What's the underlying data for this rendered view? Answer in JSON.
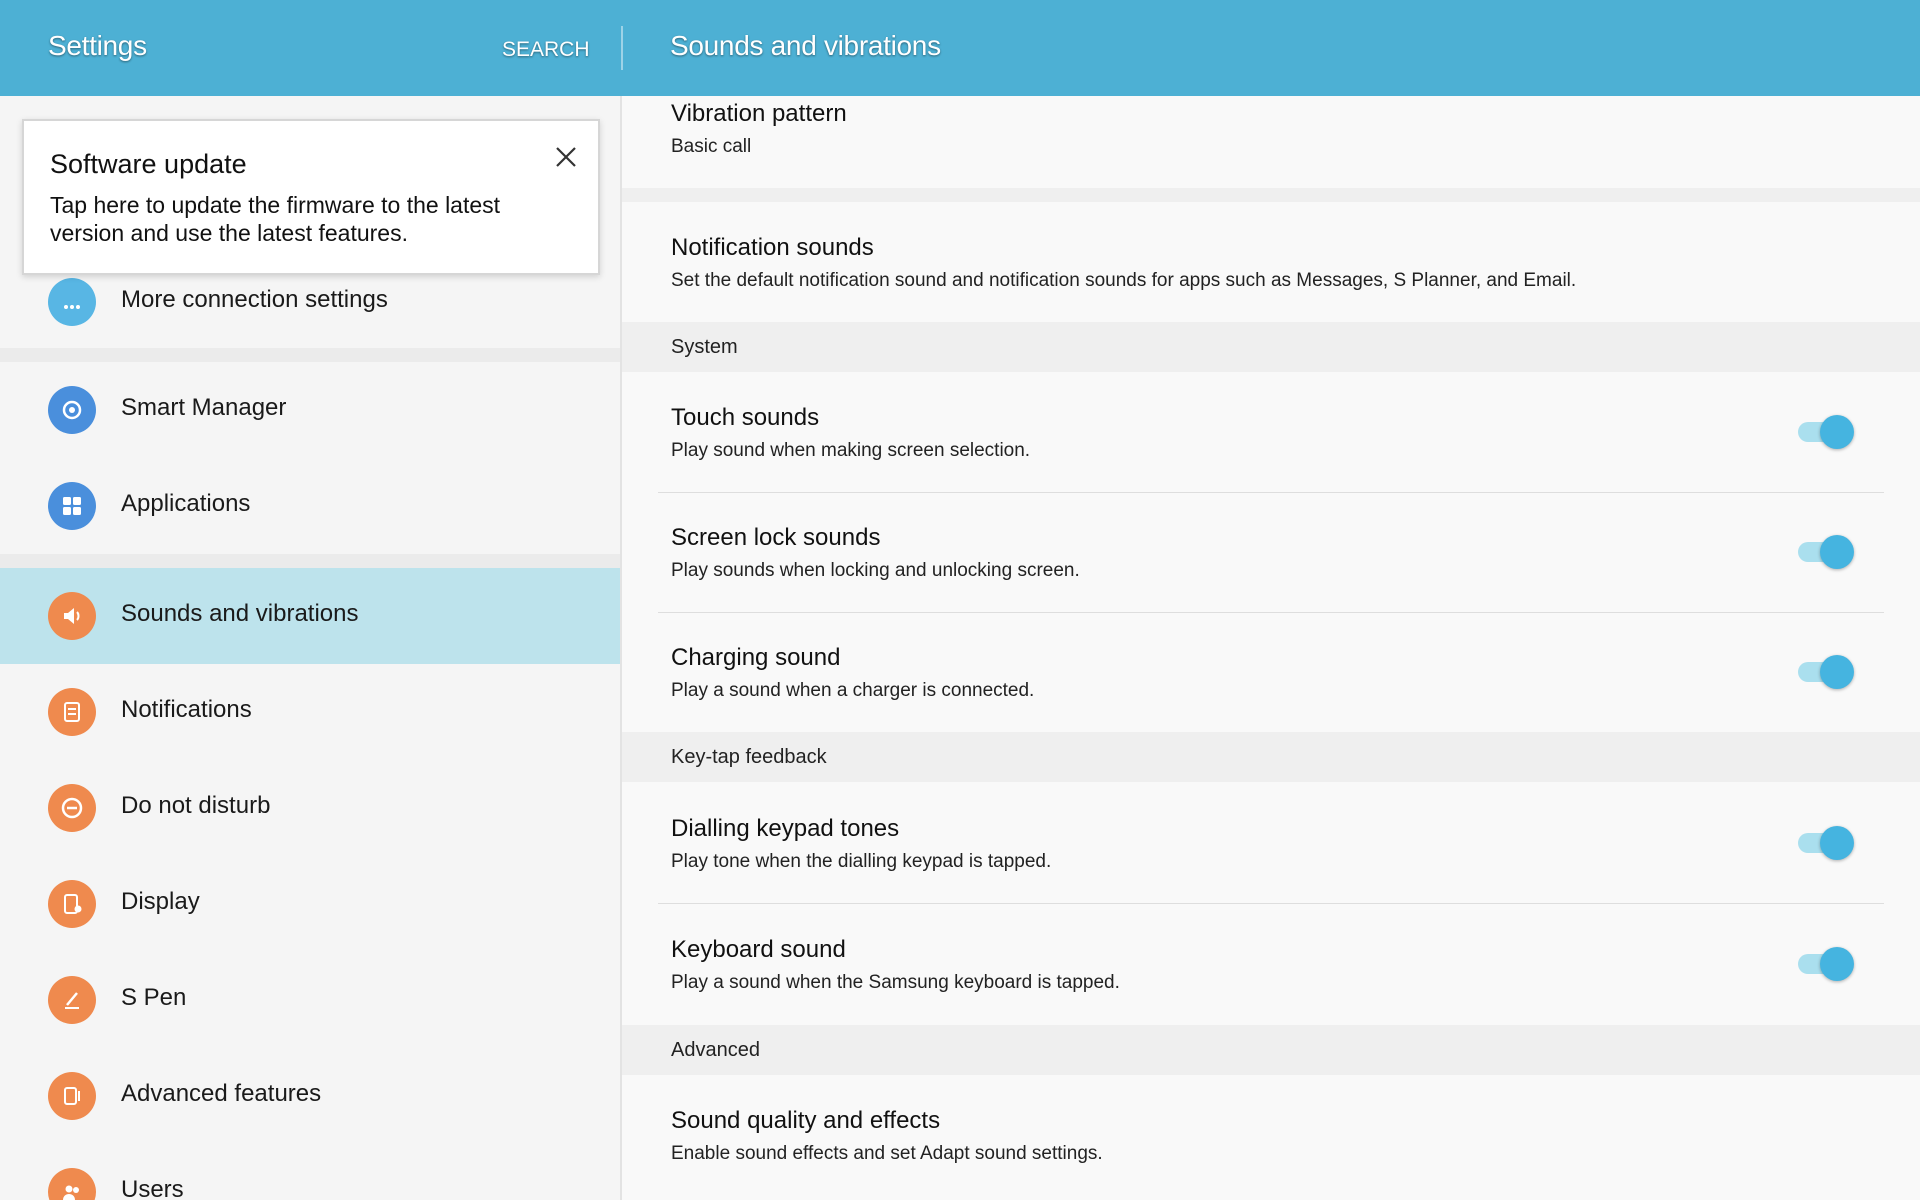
{
  "header": {
    "left_title": "Settings",
    "search_label": "SEARCH",
    "right_title": "Sounds and vibrations",
    "bg_color": "#4db0d4"
  },
  "popup": {
    "title": "Software update",
    "text": "Tap here to update the firmware to the latest version and use the latest features.",
    "close_icon": "close-icon"
  },
  "sidebar": {
    "items": [
      {
        "label": "More connection settings",
        "icon": "more-connections-icon",
        "color": "#58b6e4"
      },
      {
        "label": "Smart Manager",
        "icon": "smart-manager-icon",
        "color": "#4a8fdc"
      },
      {
        "label": "Applications",
        "icon": "applications-icon",
        "color": "#4a8fdc"
      },
      {
        "label": "Sounds and vibrations",
        "icon": "speaker-icon",
        "color": "#ef8a4e",
        "selected": true
      },
      {
        "label": "Notifications",
        "icon": "notifications-icon",
        "color": "#ef8a4e"
      },
      {
        "label": "Do not disturb",
        "icon": "do-not-disturb-icon",
        "color": "#ef8a4e"
      },
      {
        "label": "Display",
        "icon": "display-icon",
        "color": "#ef8a4e"
      },
      {
        "label": "S Pen",
        "icon": "s-pen-icon",
        "color": "#ef8a4e"
      },
      {
        "label": "Advanced features",
        "icon": "advanced-features-icon",
        "color": "#ef8a4e"
      },
      {
        "label": "Users",
        "icon": "users-icon",
        "color": "#ef8a4e"
      }
    ],
    "selected_color": "#bde3ec"
  },
  "main": {
    "vibration_pattern": {
      "title": "Vibration pattern",
      "value": "Basic call"
    },
    "notification_sounds": {
      "title": "Notification sounds",
      "desc": "Set the default notification sound and notification sounds for apps such as Messages, S Planner, and Email."
    },
    "sections": {
      "system": "System",
      "key_tap": "Key-tap feedback",
      "advanced": "Advanced"
    },
    "touch_sounds": {
      "title": "Touch sounds",
      "desc": "Play sound when making screen selection.",
      "on": true
    },
    "screen_lock_sounds": {
      "title": "Screen lock sounds",
      "desc": "Play sounds when locking and unlocking screen.",
      "on": true
    },
    "charging_sound": {
      "title": "Charging sound",
      "desc": "Play a sound when a charger is connected.",
      "on": true
    },
    "dialling_keypad_tones": {
      "title": "Dialling keypad tones",
      "desc": "Play tone when the dialling keypad is tapped.",
      "on": true
    },
    "keyboard_sound": {
      "title": "Keyboard sound",
      "desc": "Play a sound when the Samsung keyboard is tapped.",
      "on": true
    },
    "sound_quality": {
      "title": "Sound quality and effects",
      "desc": "Enable sound effects and set Adapt sound settings."
    },
    "toggle_color": "#45b4e0"
  }
}
